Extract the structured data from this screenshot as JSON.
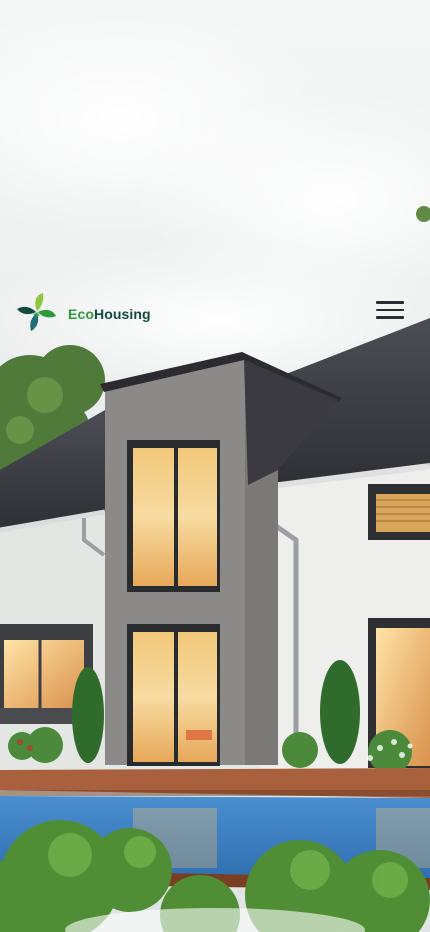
{
  "brand": {
    "name_part_1": "Eco",
    "name_part_2": "Housing",
    "logo_icon": "leaf-pinwheel-logo",
    "color_primary": "#2e9a3a",
    "color_secondary": "#134a3e"
  },
  "nav": {
    "menu_icon": "hamburger-menu-icon"
  },
  "hero": {
    "image": "modern-eco-house-with-pool"
  }
}
